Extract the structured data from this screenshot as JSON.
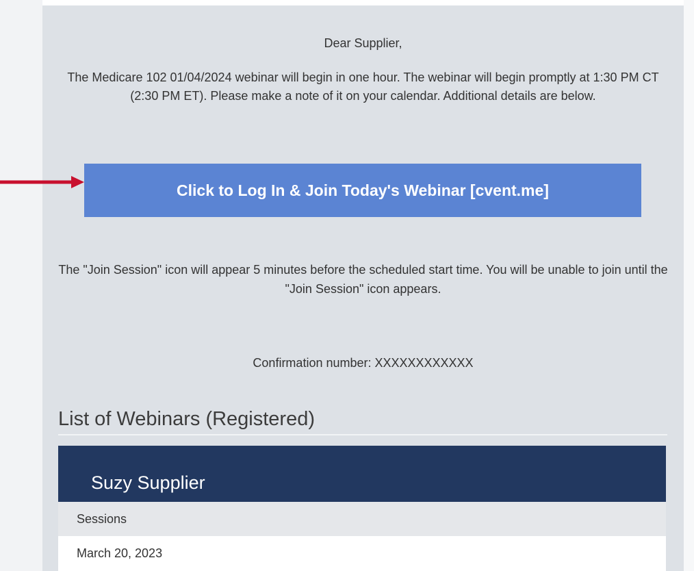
{
  "email": {
    "greeting": "Dear Supplier,",
    "intro": "The Medicare 102 01/04/2024 webinar will begin in one hour. The webinar will begin promptly at 1:30 PM CT (2:30 PM ET). Please make a note of it on your calendar. Additional details are below.",
    "join_button_label": "Click to Log In & Join Today's Webinar [cvent.me]",
    "notice": "The \"Join Session\" icon will appear 5 minutes before the scheduled start time. You will be unable to join until the \"Join Session\" icon appears.",
    "confirmation": "Confirmation number: XXXXXXXXXXXX"
  },
  "webinars": {
    "section_title": "List of Webinars (Registered)",
    "registrant_name": "Suzy Supplier",
    "sessions_header": "Sessions",
    "sessions": [
      {
        "date": "March 20, 2023"
      }
    ]
  },
  "colors": {
    "panel_bg": "#dde1e6",
    "button_bg": "#5b84d3",
    "card_header_bg": "#223860",
    "arrow": "#c8102e"
  },
  "icons": {
    "pointer": "arrow-right-icon"
  }
}
